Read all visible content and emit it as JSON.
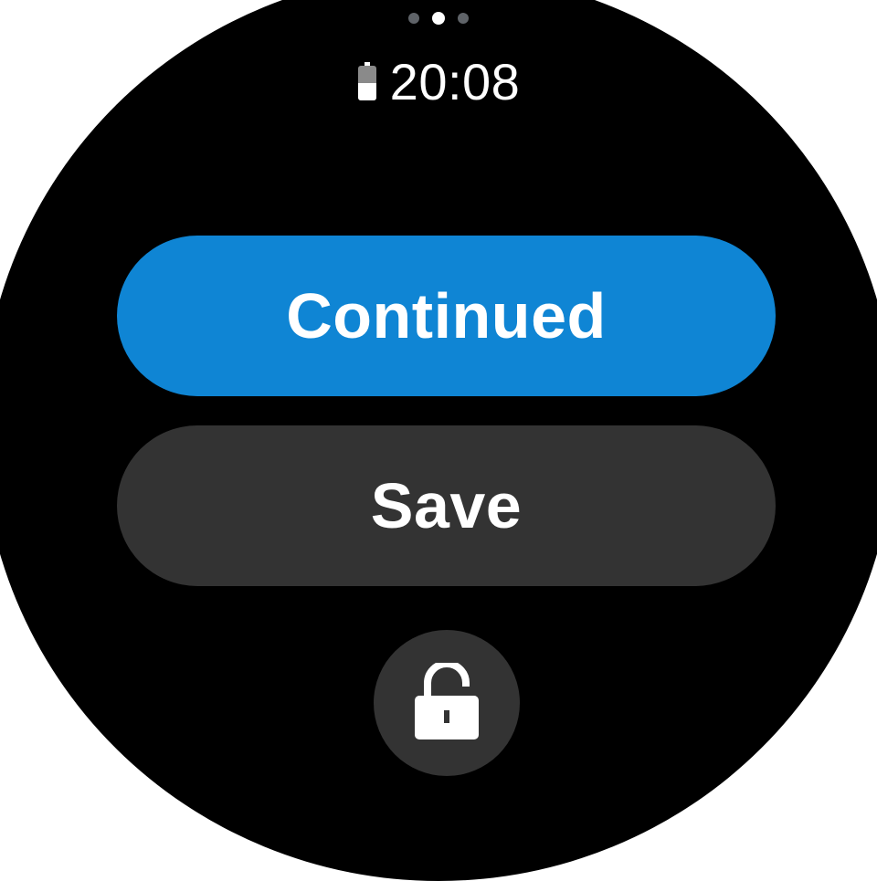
{
  "status_bar": {
    "time": "20:08",
    "battery_icon": "battery-icon"
  },
  "pagination": {
    "total": 3,
    "active_index": 1
  },
  "actions": {
    "continued_label": "Continued",
    "save_label": "Save",
    "lock_icon": "lock-open-icon"
  },
  "colors": {
    "background": "#000000",
    "primary_button": "#0f85d4",
    "secondary_button": "#333333",
    "text": "#ffffff"
  }
}
